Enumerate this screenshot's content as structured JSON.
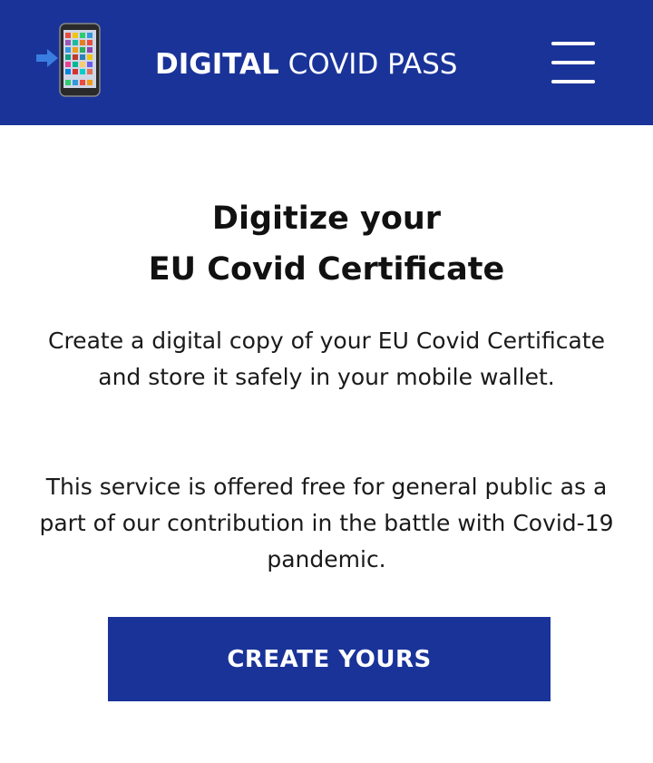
{
  "header": {
    "brand_bold": "DIGITAL",
    "brand_light": "COVID PASS",
    "logo_icon": "phone-with-arrow-icon",
    "menu_icon": "hamburger-menu-icon",
    "background_color": "#1a3399"
  },
  "main": {
    "title_line1": "Digitize your",
    "title_line2": "EU Covid Certificate",
    "description": "Create a digital copy of your EU Covid Certificate and store it safely in your mobile wallet.",
    "service_note": "This service is offered free for general public as a part of our contribution in the battle with Covid-19 pandemic.",
    "cta_label": "CREATE YOURS",
    "cta_color": "#1a3399"
  }
}
